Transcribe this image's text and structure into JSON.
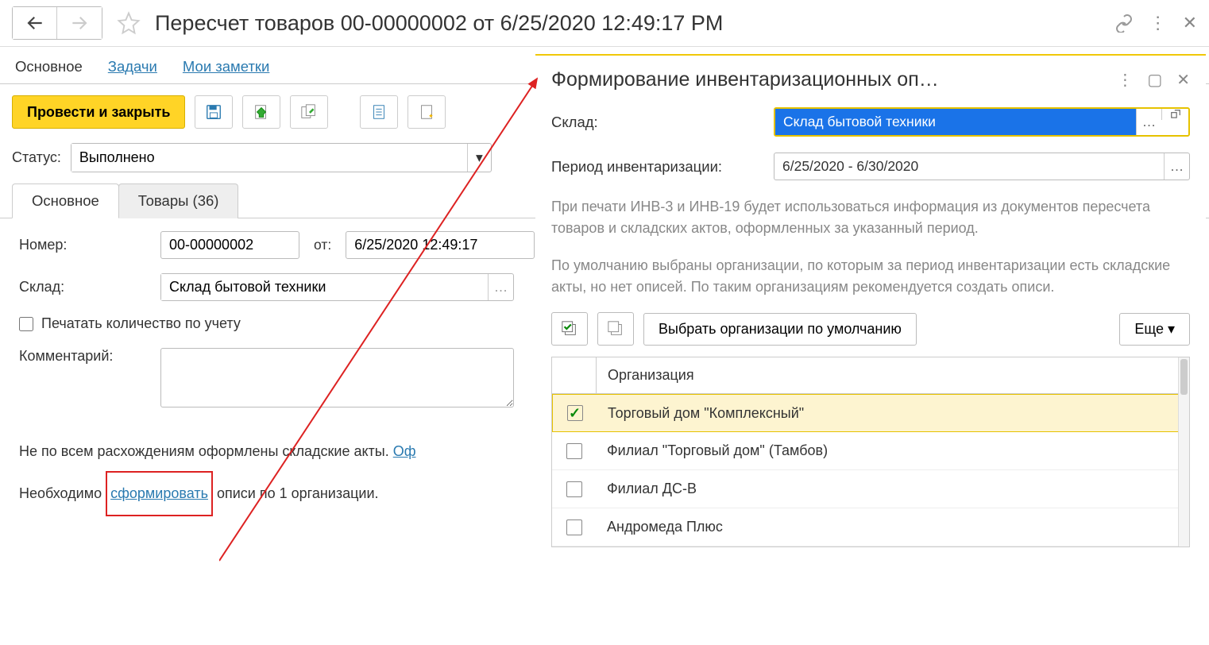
{
  "header": {
    "title": "Пересчет товаров 00-00000002 от 6/25/2020 12:49:17 PM"
  },
  "navTabs": {
    "main": "Основное",
    "tasks": "Задачи",
    "notes": "Мои заметки"
  },
  "toolbar": {
    "primary": "Провести и закрыть"
  },
  "status": {
    "label": "Статус:",
    "value": "Выполнено"
  },
  "subTabs": {
    "main": "Основное",
    "goods": "Товары (36)"
  },
  "form": {
    "numberLabel": "Номер:",
    "numberValue": "00-00000002",
    "fromLabel": "от:",
    "dateValue": "6/25/2020 12:49:17",
    "warehouseLabel": "Склад:",
    "warehouseValue": "Склад бытовой техники",
    "printQtyLabel": "Печатать количество по учету",
    "commentLabel": "Комментарий:"
  },
  "info": {
    "line1a": "Не по всем расхождениям оформлены складские акты. ",
    "line1link": "Оф",
    "line2a": "Необходимо ",
    "line2link": "сформировать",
    "line2b": " описи по 1 организации."
  },
  "dialog": {
    "title": "Формирование инвентаризационных оп…",
    "warehouseLabel": "Склад:",
    "warehouseValue": "Склад бытовой техники",
    "periodLabel": "Период инвентаризации:",
    "periodValue": "6/25/2020 - 6/30/2020",
    "info1": "При печати ИНВ-3 и ИНВ-19 будет использоваться информация из документов пересчета товаров и складских актов, оформленных за указанный период.",
    "info2": "По умолчанию выбраны организации, по которым за период инвентаризации есть складские акты, но нет описей. По таким организациям рекомендуется создать описи.",
    "defaultBtn": "Выбрать организации по умолчанию",
    "moreBtn": "Еще",
    "orgHeader": "Организация",
    "orgs": [
      {
        "name": "Торговый дом \"Комплексный\"",
        "checked": true,
        "selected": true
      },
      {
        "name": "Филиал \"Торговый дом\" (Тамбов)",
        "checked": false
      },
      {
        "name": "Филиал ДС-В",
        "checked": false
      },
      {
        "name": "Андромеда Плюс",
        "checked": false
      }
    ]
  }
}
